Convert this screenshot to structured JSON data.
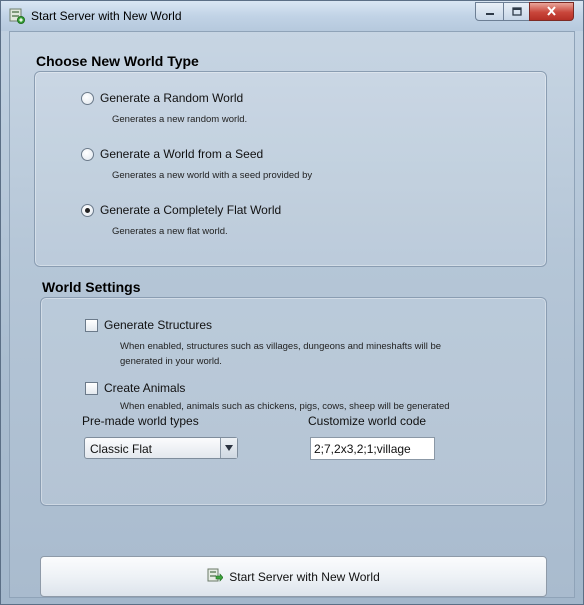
{
  "window": {
    "title": "Start Server with New World",
    "app_icon": "server-icon",
    "controls": {
      "minimize_icon": "minimize-icon",
      "maximize_icon": "maximize-icon",
      "close_icon": "close-icon"
    }
  },
  "world_type": {
    "heading": "Choose New World Type",
    "options": [
      {
        "label": "Generate a Random World",
        "description": "Generates a new random world.",
        "selected": false
      },
      {
        "label": "Generate a World from a Seed",
        "description": "Generates a new world with a seed provided by",
        "selected": false
      },
      {
        "label": "Generate a Completely Flat World",
        "description": "Generates a new flat world.",
        "selected": true
      }
    ]
  },
  "world_settings": {
    "heading": "World Settings",
    "structures": {
      "label": "Generate Structures",
      "checked": false,
      "description_line1": "When enabled, structures such as villages, dungeons and mineshafts will be",
      "description_line2": "generated in your world."
    },
    "animals": {
      "label": "Create Animals",
      "checked": false,
      "description": "When enabled, animals such as chickens, pigs, cows, sheep will be generated"
    },
    "premade_label": "Pre-made world types",
    "premade_value": "Classic Flat",
    "code_label": "Customize world code",
    "code_value": "2;7,2x3,2;1;village"
  },
  "start_button": {
    "label": "Start Server with New World",
    "icon": "server-start-icon"
  },
  "colors": {
    "close_button": "#c9463b",
    "window_frame": "#a9bccf"
  }
}
